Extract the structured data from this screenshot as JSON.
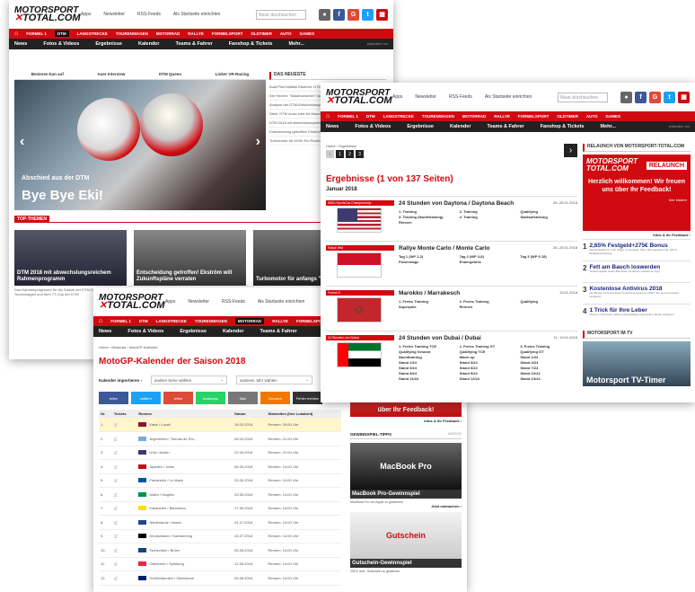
{
  "common": {
    "logo_line1": "MOTORSPORT",
    "logo_line2": "TOTAL",
    "logo_tld": ".COM",
    "top_links": [
      "Apps",
      "Newsletter",
      "RSS-Feeds",
      "Als Startseite einrichten"
    ],
    "search_placeholder": "Neue durchsuchen",
    "nav_primary": [
      "FORMEL 1",
      "DTM",
      "LANGSTRECKE",
      "TOURENWAGEN",
      "MOTORRAD",
      "RALLYE",
      "FORMELSPORT",
      "OLDTIMER",
      "AUTO",
      "GAMES"
    ],
    "nav_secondary": [
      "News",
      "Fotos & Videos",
      "Ergebnisse",
      "Kalender",
      "Teams & Fahrer",
      "Fanshop & Tickets",
      "Mehr..."
    ],
    "presented": "präsentiert von",
    "colors": {
      "brand_red": "#d10a11",
      "nav_dark": "#222222"
    }
  },
  "win_home": {
    "tabs": [
      "Besieren kan auf",
      "Auer Interview",
      "DTM Queen",
      "Linker VR-Racing"
    ],
    "hero_kicker": "Abschied aus der DTM",
    "hero_title": "Bye Bye Eki!",
    "news_head": "DAS NEUESTE",
    "news": [
      "Audi-Pilot Mattias Ekström: DTM-Karriere",
      "Die Herzen: \"Naturburschen\" hat seine große Liebe",
      "Analyse der DTM-Entscheidungen: Jahre im Eindtag",
      "Stein: DTM muss eine Art Muscle-Car-Serie bleiben",
      "DTM 2018 mit abwechslungsreichem Rahmenprogramm",
      "Entscheidung getroffen! Ekström will Zukunftspläne verraten",
      "Turbomotor für 2018: Ein Rückblick anfang \"nicht gefragt\""
    ],
    "top_themen": "TOP-THEMEN",
    "cards": [
      "DTM 2018 mit abwechslungsreichem Rahmenprogramm",
      "Entscheidung getroffen! Ekström will Zukunftspläne verraten",
      "Turbomotor für anfangs \"nicht gefragt\""
    ],
    "excerpt": "Das Rahmenprogramm für die Saison der DTM 2018 mit historischen Tourenwagen und dem TT-Cup der DTM"
  },
  "win_results": {
    "breadcrumb": "Home › Ergebnisse",
    "pages": [
      "1",
      "2",
      "3"
    ],
    "title": "Ergebnisse (1 von 137 Seiten)",
    "month": "Januar 2018",
    "races": [
      {
        "series": "IMSA SportsCar Championship",
        "name": "24 Stunden von Daytona / Daytona Beach",
        "date": "26.-28.01.2018",
        "flag": "us",
        "sessions": [
          "1. Training",
          "2. Training",
          "Qualifying",
          "3. Training (Nachttraining)",
          "4. Training",
          "Startaufstellung",
          "Rennen",
          "",
          ""
        ]
      },
      {
        "series": "Rallye WM",
        "name": "Rallye Monte Carlo / Monte Carlo",
        "date": "26.-28.01.2018",
        "flag": "mc",
        "sessions": [
          "Tag 1 (WP 1-2)",
          "Tag 2 (WP 3-8)",
          "Tag 3 (WP 9-15)",
          "Powerstage",
          "Endergebnis",
          "",
          "",
          "",
          ""
        ]
      },
      {
        "series": "Formel E",
        "name": "Marokko / Marrakesch",
        "date": "13.01.2018",
        "flag": "ma",
        "sessions": [
          "1. Freies Training",
          "2. Freies Training",
          "Qualifying",
          "Superpole",
          "Rennen",
          "",
          "",
          "",
          ""
        ]
      },
      {
        "series": "24 Stunden von Dubai",
        "name": "24 Stunden von Dubai / Dubai",
        "date": "11.-13.01.2018",
        "flag": "ae",
        "sessions": [
          "1. Freies Training TCE",
          "2. Freies Training GT",
          "3. Freies Training",
          "Qualifying Gesamt",
          "Qualifying TCE",
          "Qualifying GT",
          "Nachttraining",
          "Warm up",
          "Stand 1/24",
          "Stand 2/24",
          "Stand 3/24",
          "Stand 4/24",
          "Stand 5/24",
          "Stand 6/24",
          "Stand 7/24",
          "Stand 8/24",
          "Stand 9/24",
          "Stand 10/24",
          "Stand 11/24",
          "Stand 12/24",
          "Stand 13/24"
        ]
      }
    ],
    "side_head": "RELAUNCH VON MOTORSPORT-TOTAL.COM",
    "relaunch_badge": "RELAUNCH",
    "relaunch_msg": "Herzlich willkommen! Wir freuen uns über Ihr Feedback!",
    "relaunch_more": "hier klicken",
    "info_link": "Infos & Ihr Feedback ›",
    "ads": [
      {
        "n": "1",
        "t": "2,65% Festgeld+275€ Bonus",
        "s": "Deutschlands Nr. 1 für Tages- & Festgeld. Über 150 Angebote inkl. 100 % Einlagensicherung"
      },
      {
        "n": "2",
        "t": "Fett am Bauch loswerden",
        "s": "Verliere täglich etwas Bauchfett mit diesem seltsamen Tipp"
      },
      {
        "n": "3",
        "t": "Kostenlose Antivirus 2018",
        "s": "Die Besten 10 Kostenlosen Antivirenprogramme 2018. Hier ist ein besserer Vergleich!"
      },
      {
        "n": "4",
        "t": "1 Trick für Ihre Leber",
        "s": "Dieser 1 Trick kann selbst unbeschädigte Leberzellen wieder aufbauen"
      }
    ],
    "tv_head": "MOTORSPORT IM TV",
    "tv_title": "Motorsport TV-Timer"
  },
  "win_calendar": {
    "breadcrumb": "Home › Motorrad › MotoGP-Kalender",
    "title": "MotoGP-Kalender der Saison 2018",
    "import_label": "Kalender importieren ›",
    "select1": "andere Serie wählen",
    "select2": "anderes Jahr wählen",
    "share": [
      "teilen",
      "twittern",
      "teilen",
      "whatsapp",
      "Mail",
      "Drucken",
      "Fehler melden"
    ],
    "columns": [
      "Nr.",
      "Tickets",
      "Rennen",
      "Datum",
      "Startzeiten (Ihre Lokalzeit)"
    ],
    "rows": [
      {
        "nr": "1.",
        "race": "Katar / Losail",
        "date": "18.03.2018",
        "time": "Rennen: 20:00 Uhr",
        "flag": "#8a1538"
      },
      {
        "nr": "2.",
        "race": "Argentinien / Termas de Río...",
        "date": "08.04.2018",
        "time": "Rennen: 21:00 Uhr",
        "flag": "#74acdf"
      },
      {
        "nr": "3.",
        "race": "USA / Austin",
        "date": "22.04.2018",
        "time": "Rennen: 21:00 Uhr",
        "flag": "#3c3b6e"
      },
      {
        "nr": "4.",
        "race": "Spanien / Jerez",
        "date": "06.05.2018",
        "time": "Rennen: 14:00 Uhr",
        "flag": "#c60b1e"
      },
      {
        "nr": "5.",
        "race": "Frankreich / Le Mans",
        "date": "20.05.2018",
        "time": "Rennen: 14:00 Uhr",
        "flag": "#0055a4"
      },
      {
        "nr": "6.",
        "race": "Italien / Mugello",
        "date": "03.06.2018",
        "time": "Rennen: 14:00 Uhr",
        "flag": "#009246"
      },
      {
        "nr": "7.",
        "race": "Katalonien / Barcelona",
        "date": "17.06.2018",
        "time": "Rennen: 14:00 Uhr",
        "flag": "#fcdd09"
      },
      {
        "nr": "8.",
        "race": "Niederlande / Assen",
        "date": "01.07.2018",
        "time": "Rennen: 14:00 Uhr",
        "flag": "#21468b"
      },
      {
        "nr": "9.",
        "race": "Deutschland / Sachsenring",
        "date": "15.07.2018",
        "time": "Rennen: 14:00 Uhr",
        "flag": "#000000"
      },
      {
        "nr": "10.",
        "race": "Tschechien / Brünn",
        "date": "05.08.2018",
        "time": "Rennen: 14:00 Uhr",
        "flag": "#11457e"
      },
      {
        "nr": "11.",
        "race": "Österreich / Spielberg",
        "date": "12.08.2018",
        "time": "Rennen: 14:00 Uhr",
        "flag": "#ed2939"
      },
      {
        "nr": "12.",
        "race": "Großbritannien / Silverstone",
        "date": "26.08.2018",
        "time": "Rennen: 14:00 Uhr",
        "flag": "#012169"
      }
    ],
    "side_feedback": "über Ihr Feedback!",
    "info_link": "Infos & Ihr Feedback ›",
    "gw_head": "GEWINNSPIEL-TIPPS",
    "gw_ad": "ANZEIGE",
    "gw1_img": "MacBook Pro",
    "gw1_title": "MacBook Pro-Gewinnspiel",
    "gw1_sub": "MacBook Pro von Apple zu gewinnen!",
    "gw1_link": "Jetzt mitmachen ›",
    "gw2_img": "Gutschein",
    "gw2_title": "Gutschein-Gewinnspiel",
    "gw2_sub": "200 € real,- Gutschein zu gewinnen."
  }
}
